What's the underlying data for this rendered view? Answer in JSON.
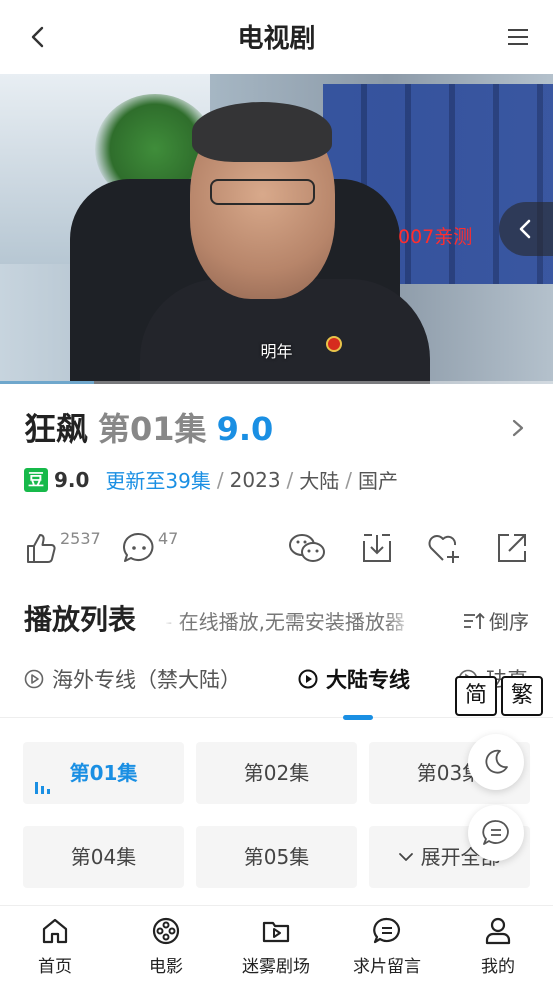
{
  "header": {
    "title": "电视剧",
    "back_icon": "chevron-left-icon",
    "menu_icon": "menu-icon"
  },
  "video": {
    "watermark": "007亲测",
    "subtitle": "明年",
    "side_button_icon": "chevron-left-icon",
    "progress": 0.17
  },
  "info": {
    "show_name": "狂飙",
    "episode": "第01集",
    "score": "9.0",
    "douban_badge": "豆",
    "douban_score": "9.0",
    "update": "更新至39集",
    "year": "2023",
    "region": "大陆",
    "origin": "国产",
    "separator": "/"
  },
  "actions": {
    "like_count": "2537",
    "comment_count": "47"
  },
  "playlist": {
    "title": "播放列表",
    "marquee": "- 在线播放,无需安装播放器",
    "sort_label": "倒序",
    "lines": [
      {
        "label": "海外专线（禁大陆）"
      },
      {
        "label": "大陆专线"
      },
      {
        "label": "珐真"
      }
    ],
    "simplified": "简",
    "traditional": "繁"
  },
  "episodes": [
    {
      "label": "第01集"
    },
    {
      "label": "第02集"
    },
    {
      "label": "第03集"
    },
    {
      "label": "第04集"
    },
    {
      "label": "第05集"
    },
    {
      "label": "展开全部"
    }
  ],
  "tabs": [
    {
      "label": "首页",
      "icon": "home-icon"
    },
    {
      "label": "电影",
      "icon": "film-reel-icon"
    },
    {
      "label": "迷雾剧场",
      "icon": "folder-play-icon"
    },
    {
      "label": "求片留言",
      "icon": "message-icon"
    },
    {
      "label": "我的",
      "icon": "user-icon"
    }
  ],
  "colors": {
    "accent": "#1a8fe3",
    "douban": "#17b94a",
    "watermark": "#ff2d2d"
  }
}
